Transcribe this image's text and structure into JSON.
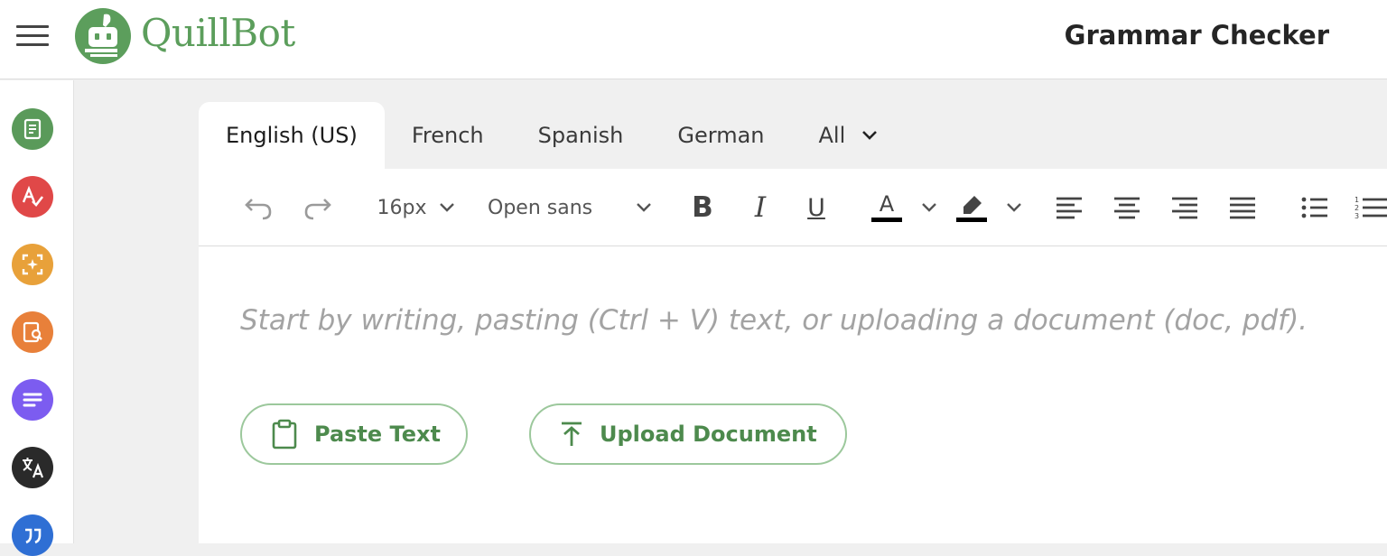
{
  "header": {
    "brand": "QuillBot",
    "page_title": "Grammar Checker",
    "menu_icon": "hamburger-menu-icon",
    "logo_icon": "quillbot-robot-logo"
  },
  "sidebar": {
    "items": [
      {
        "icon": "paraphraser-icon",
        "color": "#5a9a5a"
      },
      {
        "icon": "grammar-checker-icon",
        "color": "#e04848"
      },
      {
        "icon": "ai-detector-icon",
        "color": "#e8a13a"
      },
      {
        "icon": "plagiarism-checker-icon",
        "color": "#e8803a"
      },
      {
        "icon": "summarizer-icon",
        "color": "#7c5cf0"
      },
      {
        "icon": "translator-icon",
        "color": "#2a2a2a"
      },
      {
        "icon": "citation-generator-icon",
        "color": "#2f6fd4"
      }
    ]
  },
  "language_tabs": {
    "items": [
      "English (US)",
      "French",
      "Spanish",
      "German",
      "All"
    ],
    "active": "English (US)"
  },
  "toolbar": {
    "font_size": "16px",
    "font_family": "Open sans",
    "bold_label": "B",
    "italic_label": "I",
    "underline_label": "U",
    "text_color_label": "A",
    "text_color": "#000000",
    "highlight_color": "#000000"
  },
  "editor": {
    "placeholder": "Start by writing, pasting (Ctrl + V) text, or uploading a document (doc, pdf).",
    "paste_button": "Paste Text",
    "upload_button": "Upload Document"
  },
  "colors": {
    "brand_green": "#5c9e5c",
    "button_border": "#9cc89c",
    "button_text": "#4d8a4d"
  }
}
